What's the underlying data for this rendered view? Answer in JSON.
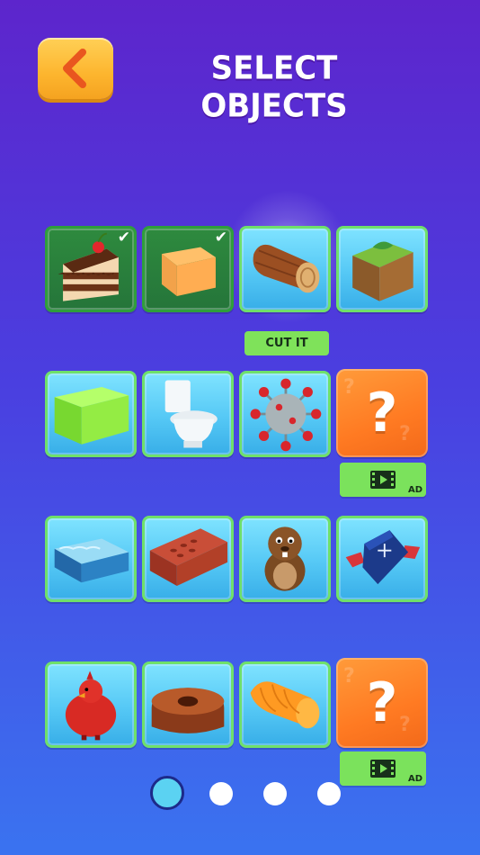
{
  "header": {
    "title": "SELECT OBJECTS",
    "back_icon": "chevron-left-icon"
  },
  "tiles": [
    {
      "name": "cake",
      "selected": true
    },
    {
      "name": "cheese-block",
      "selected": true
    },
    {
      "name": "log",
      "selected": false
    },
    {
      "name": "grass-block",
      "selected": false
    },
    {
      "name": "green-jelly-block",
      "selected": false
    },
    {
      "name": "toilet",
      "selected": false
    },
    {
      "name": "virus",
      "selected": false
    },
    {
      "name": "mystery-1",
      "locked": true
    },
    {
      "name": "water-block",
      "selected": false
    },
    {
      "name": "brick",
      "selected": false
    },
    {
      "name": "beaver",
      "selected": false
    },
    {
      "name": "coffin",
      "selected": false
    },
    {
      "name": "red-bird",
      "selected": false
    },
    {
      "name": "bundt-cake",
      "selected": false
    },
    {
      "name": "orange-roll",
      "selected": false
    },
    {
      "name": "mystery-2",
      "locked": true
    }
  ],
  "mystery_symbol": "?",
  "cut_button": {
    "label": "CUT IT"
  },
  "ad_buttons": [
    {
      "label": "AD",
      "icon": "film-icon"
    },
    {
      "label": "AD",
      "icon": "film-icon"
    }
  ],
  "pagination": {
    "pages": 4,
    "current": 1
  },
  "colors": {
    "bg_top": "#5d25cc",
    "bg_bottom": "#3a73f0",
    "tile_border": "#6fe06a",
    "selected_tile": "#2e8a3e",
    "button_green": "#7be25c",
    "back_button": "#fdb52e"
  }
}
